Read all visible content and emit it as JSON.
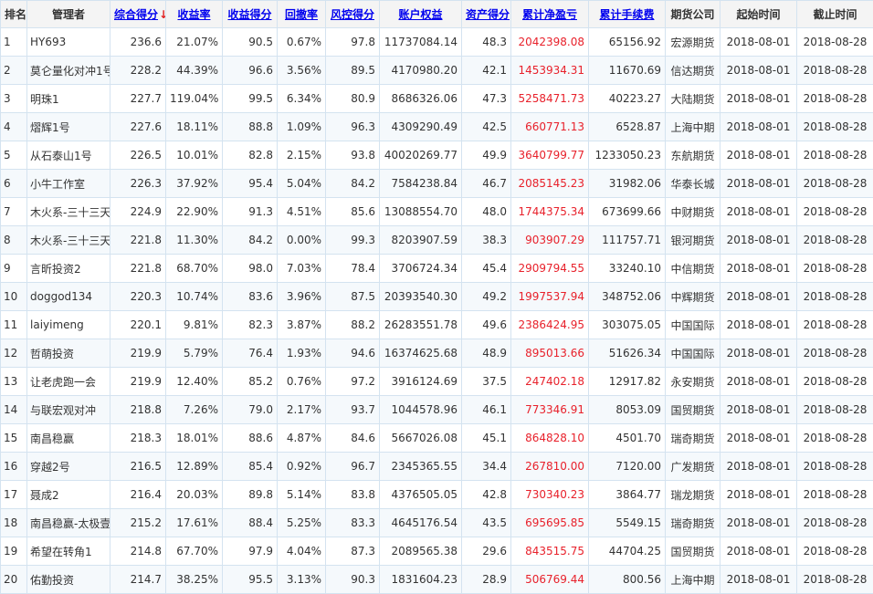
{
  "colors": {
    "link": "#0000ee",
    "red": "#e8212b",
    "border": "#d4e3f0"
  },
  "headers": [
    {
      "key": "rank",
      "label": "排名",
      "sortable": false,
      "name": "header-rank"
    },
    {
      "key": "manager",
      "label": "管理者",
      "sortable": false,
      "name": "header-manager"
    },
    {
      "key": "composite",
      "label": "综合得分",
      "sortable": true,
      "sorted": true,
      "arrow": "↓",
      "name": "header-composite-score"
    },
    {
      "key": "return_rate",
      "label": "收益率",
      "sortable": true,
      "name": "header-return-rate"
    },
    {
      "key": "return_score",
      "label": "收益得分",
      "sortable": true,
      "name": "header-return-score"
    },
    {
      "key": "drawdown",
      "label": "回撤率",
      "sortable": true,
      "name": "header-drawdown"
    },
    {
      "key": "risk_score",
      "label": "风控得分",
      "sortable": true,
      "name": "header-risk-score"
    },
    {
      "key": "equity",
      "label": "账户权益",
      "sortable": true,
      "name": "header-equity"
    },
    {
      "key": "asset_score",
      "label": "资产得分",
      "sortable": true,
      "name": "header-asset-score"
    },
    {
      "key": "net_pnl",
      "label": "累计净盈亏",
      "sortable": true,
      "name": "header-net-pnl"
    },
    {
      "key": "fees",
      "label": "累计手续费",
      "sortable": true,
      "name": "header-fees"
    },
    {
      "key": "broker",
      "label": "期货公司",
      "sortable": false,
      "name": "header-broker"
    },
    {
      "key": "start",
      "label": "起始时间",
      "sortable": false,
      "name": "header-start-date"
    },
    {
      "key": "end",
      "label": "截止时间",
      "sortable": false,
      "name": "header-end-date"
    }
  ],
  "rows": [
    [
      "1",
      "HY693",
      "236.6",
      "21.07%",
      "90.5",
      "0.67%",
      "97.8",
      "11737084.14",
      "48.3",
      "2042398.08",
      "65156.92",
      "宏源期货",
      "2018-08-01",
      "2018-08-28"
    ],
    [
      "2",
      "莫仑量化对冲1号",
      "228.2",
      "44.39%",
      "96.6",
      "3.56%",
      "89.5",
      "4170980.20",
      "42.1",
      "1453934.31",
      "11670.69",
      "信达期货",
      "2018-08-01",
      "2018-08-28"
    ],
    [
      "3",
      "明珠1",
      "227.7",
      "119.04%",
      "99.5",
      "6.34%",
      "80.9",
      "8686326.06",
      "47.3",
      "5258471.73",
      "40223.27",
      "大陆期货",
      "2018-08-01",
      "2018-08-28"
    ],
    [
      "4",
      "熠辉1号",
      "227.6",
      "18.11%",
      "88.8",
      "1.09%",
      "96.3",
      "4309290.49",
      "42.5",
      "660771.13",
      "6528.87",
      "上海中期",
      "2018-08-01",
      "2018-08-28"
    ],
    [
      "5",
      "从石泰山1号",
      "226.5",
      "10.01%",
      "82.8",
      "2.15%",
      "93.8",
      "40020269.77",
      "49.9",
      "3640799.77",
      "1233050.23",
      "东航期货",
      "2018-08-01",
      "2018-08-28"
    ],
    [
      "6",
      "小牛工作室",
      "226.3",
      "37.92%",
      "95.4",
      "5.04%",
      "84.2",
      "7584238.84",
      "46.7",
      "2085145.23",
      "31982.06",
      "华泰长城",
      "2018-08-01",
      "2018-08-28"
    ],
    [
      "7",
      "木火系-三十三天",
      "224.9",
      "22.90%",
      "91.3",
      "4.51%",
      "85.6",
      "13088554.70",
      "48.0",
      "1744375.34",
      "673699.66",
      "中财期货",
      "2018-08-01",
      "2018-08-28"
    ],
    [
      "8",
      "木火系-三十三天",
      "221.8",
      "11.30%",
      "84.2",
      "0.00%",
      "99.3",
      "8203907.59",
      "38.3",
      "903907.29",
      "111757.71",
      "银河期货",
      "2018-08-01",
      "2018-08-28"
    ],
    [
      "9",
      "言昕投资2",
      "221.8",
      "68.70%",
      "98.0",
      "7.03%",
      "78.4",
      "3706724.34",
      "45.4",
      "2909794.55",
      "33240.10",
      "中信期货",
      "2018-08-01",
      "2018-08-28"
    ],
    [
      "10",
      "doggod134",
      "220.3",
      "10.74%",
      "83.6",
      "3.96%",
      "87.5",
      "20393540.30",
      "49.2",
      "1997537.94",
      "348752.06",
      "中辉期货",
      "2018-08-01",
      "2018-08-28"
    ],
    [
      "11",
      "laiyimeng",
      "220.1",
      "9.81%",
      "82.3",
      "3.87%",
      "88.2",
      "26283551.78",
      "49.6",
      "2386424.95",
      "303075.05",
      "中国国际",
      "2018-08-01",
      "2018-08-28"
    ],
    [
      "12",
      "哲萌投资",
      "219.9",
      "5.79%",
      "76.4",
      "1.93%",
      "94.6",
      "16374625.68",
      "48.9",
      "895013.66",
      "51626.34",
      "中国国际",
      "2018-08-01",
      "2018-08-28"
    ],
    [
      "13",
      "让老虎跑一会",
      "219.9",
      "12.40%",
      "85.2",
      "0.76%",
      "97.2",
      "3916124.69",
      "37.5",
      "247402.18",
      "12917.82",
      "永安期货",
      "2018-08-01",
      "2018-08-28"
    ],
    [
      "14",
      "与联宏观对冲",
      "218.8",
      "7.26%",
      "79.0",
      "2.17%",
      "93.7",
      "1044578.96",
      "46.1",
      "773346.91",
      "8053.09",
      "国贸期货",
      "2018-08-01",
      "2018-08-28"
    ],
    [
      "15",
      "南昌稳赢",
      "218.3",
      "18.01%",
      "88.6",
      "4.87%",
      "84.6",
      "5667026.08",
      "45.1",
      "864828.10",
      "4501.70",
      "瑞奇期货",
      "2018-08-01",
      "2018-08-28"
    ],
    [
      "16",
      "穿越2号",
      "216.5",
      "12.89%",
      "85.4",
      "0.92%",
      "96.7",
      "2345365.55",
      "34.4",
      "267810.00",
      "7120.00",
      "广发期货",
      "2018-08-01",
      "2018-08-28"
    ],
    [
      "17",
      "聂成2",
      "216.4",
      "20.03%",
      "89.8",
      "5.14%",
      "83.8",
      "4376505.05",
      "42.8",
      "730340.23",
      "3864.77",
      "瑞龙期货",
      "2018-08-01",
      "2018-08-28"
    ],
    [
      "18",
      "南昌稳赢-太极壹号",
      "215.2",
      "17.61%",
      "88.4",
      "5.25%",
      "83.3",
      "4645176.54",
      "43.5",
      "695695.85",
      "5549.15",
      "瑞奇期货",
      "2018-08-01",
      "2018-08-28"
    ],
    [
      "19",
      "希望在转角1",
      "214.8",
      "67.70%",
      "97.9",
      "4.04%",
      "87.3",
      "2089565.38",
      "29.6",
      "843515.75",
      "44704.25",
      "国贸期货",
      "2018-08-01",
      "2018-08-28"
    ],
    [
      "20",
      "佑勤投资",
      "214.7",
      "38.25%",
      "95.5",
      "3.13%",
      "90.3",
      "1831604.23",
      "28.9",
      "506769.44",
      "800.56",
      "上海中期",
      "2018-08-01",
      "2018-08-28"
    ]
  ]
}
